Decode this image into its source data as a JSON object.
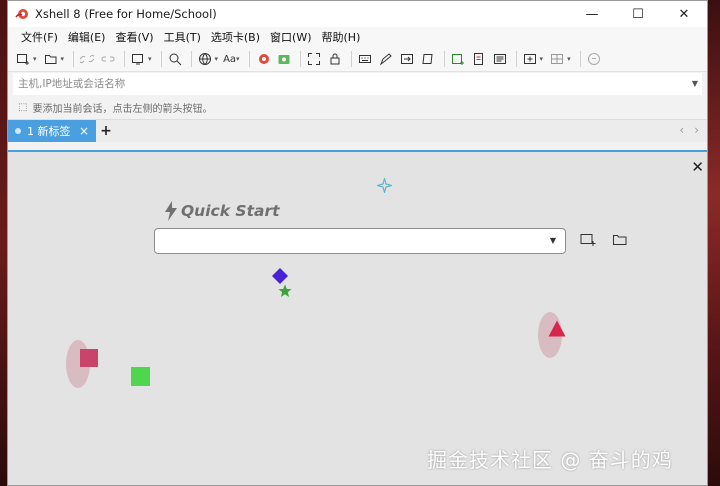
{
  "window": {
    "title": "Xshell 8 (Free for Home/School)",
    "controls": {
      "minimize": "—",
      "maximize": "☐",
      "close": "✕"
    }
  },
  "menu": [
    {
      "label": "文件(F)"
    },
    {
      "label": "编辑(E)"
    },
    {
      "label": "查看(V)"
    },
    {
      "label": "工具(T)"
    },
    {
      "label": "选项卡(B)"
    },
    {
      "label": "窗口(W)"
    },
    {
      "label": "帮助(H)"
    }
  ],
  "toolbar": {
    "font_label": "Aa",
    "icons": [
      "new-session-icon",
      "open-folder-icon",
      "link-icon",
      "unlink-icon",
      "screen-icon",
      "search-icon",
      "globe-icon",
      "font-icon",
      "xshell-icon",
      "xftp-icon",
      "fullscreen-icon",
      "lock-icon",
      "keyboard-icon",
      "compose-icon",
      "transfer-icon",
      "script-icon",
      "new-tab-icon",
      "log-icon",
      "notes-icon",
      "add-window-icon",
      "layout-icon",
      "help-icon"
    ]
  },
  "address_bar": {
    "placeholder": "主机,IP地址或会话名称",
    "value": ""
  },
  "hint": {
    "text": "要添加当前会话，点击左侧的箭头按钮。"
  },
  "tabs": [
    {
      "label": "1 新标签",
      "active": true,
      "close": "×"
    }
  ],
  "tab_add": "+",
  "tab_nav": {
    "prev": "‹",
    "next": "›"
  },
  "quick_start": {
    "title": "Quick Start",
    "input_value": "",
    "close": "✕"
  },
  "watermark": "掘金技术社区 @ 奋斗的鸡",
  "colors": {
    "tab_active": "#4a9fe0",
    "content_bg": "#e3e3e3",
    "diamond": "#4a22d8",
    "star": "#3aa33a",
    "square_pink": "#c9436a",
    "square_green": "#4fd64f",
    "triangle": "#d8264a",
    "sparkle": "#5fb5c9"
  }
}
